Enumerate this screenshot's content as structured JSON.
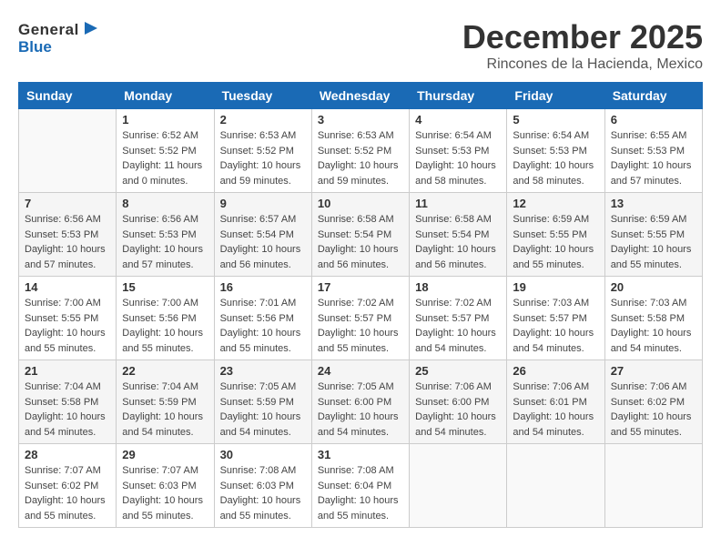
{
  "header": {
    "logo_general": "General",
    "logo_blue": "Blue",
    "month": "December 2025",
    "location": "Rincones de la Hacienda, Mexico"
  },
  "weekdays": [
    "Sunday",
    "Monday",
    "Tuesday",
    "Wednesday",
    "Thursday",
    "Friday",
    "Saturday"
  ],
  "weeks": [
    [
      {
        "day": "",
        "sunrise": "",
        "sunset": "",
        "daylight": ""
      },
      {
        "day": "1",
        "sunrise": "Sunrise: 6:52 AM",
        "sunset": "Sunset: 5:52 PM",
        "daylight": "Daylight: 11 hours and 0 minutes."
      },
      {
        "day": "2",
        "sunrise": "Sunrise: 6:53 AM",
        "sunset": "Sunset: 5:52 PM",
        "daylight": "Daylight: 10 hours and 59 minutes."
      },
      {
        "day": "3",
        "sunrise": "Sunrise: 6:53 AM",
        "sunset": "Sunset: 5:52 PM",
        "daylight": "Daylight: 10 hours and 59 minutes."
      },
      {
        "day": "4",
        "sunrise": "Sunrise: 6:54 AM",
        "sunset": "Sunset: 5:53 PM",
        "daylight": "Daylight: 10 hours and 58 minutes."
      },
      {
        "day": "5",
        "sunrise": "Sunrise: 6:54 AM",
        "sunset": "Sunset: 5:53 PM",
        "daylight": "Daylight: 10 hours and 58 minutes."
      },
      {
        "day": "6",
        "sunrise": "Sunrise: 6:55 AM",
        "sunset": "Sunset: 5:53 PM",
        "daylight": "Daylight: 10 hours and 57 minutes."
      }
    ],
    [
      {
        "day": "7",
        "sunrise": "Sunrise: 6:56 AM",
        "sunset": "Sunset: 5:53 PM",
        "daylight": "Daylight: 10 hours and 57 minutes."
      },
      {
        "day": "8",
        "sunrise": "Sunrise: 6:56 AM",
        "sunset": "Sunset: 5:53 PM",
        "daylight": "Daylight: 10 hours and 57 minutes."
      },
      {
        "day": "9",
        "sunrise": "Sunrise: 6:57 AM",
        "sunset": "Sunset: 5:54 PM",
        "daylight": "Daylight: 10 hours and 56 minutes."
      },
      {
        "day": "10",
        "sunrise": "Sunrise: 6:58 AM",
        "sunset": "Sunset: 5:54 PM",
        "daylight": "Daylight: 10 hours and 56 minutes."
      },
      {
        "day": "11",
        "sunrise": "Sunrise: 6:58 AM",
        "sunset": "Sunset: 5:54 PM",
        "daylight": "Daylight: 10 hours and 56 minutes."
      },
      {
        "day": "12",
        "sunrise": "Sunrise: 6:59 AM",
        "sunset": "Sunset: 5:55 PM",
        "daylight": "Daylight: 10 hours and 55 minutes."
      },
      {
        "day": "13",
        "sunrise": "Sunrise: 6:59 AM",
        "sunset": "Sunset: 5:55 PM",
        "daylight": "Daylight: 10 hours and 55 minutes."
      }
    ],
    [
      {
        "day": "14",
        "sunrise": "Sunrise: 7:00 AM",
        "sunset": "Sunset: 5:55 PM",
        "daylight": "Daylight: 10 hours and 55 minutes."
      },
      {
        "day": "15",
        "sunrise": "Sunrise: 7:00 AM",
        "sunset": "Sunset: 5:56 PM",
        "daylight": "Daylight: 10 hours and 55 minutes."
      },
      {
        "day": "16",
        "sunrise": "Sunrise: 7:01 AM",
        "sunset": "Sunset: 5:56 PM",
        "daylight": "Daylight: 10 hours and 55 minutes."
      },
      {
        "day": "17",
        "sunrise": "Sunrise: 7:02 AM",
        "sunset": "Sunset: 5:57 PM",
        "daylight": "Daylight: 10 hours and 55 minutes."
      },
      {
        "day": "18",
        "sunrise": "Sunrise: 7:02 AM",
        "sunset": "Sunset: 5:57 PM",
        "daylight": "Daylight: 10 hours and 54 minutes."
      },
      {
        "day": "19",
        "sunrise": "Sunrise: 7:03 AM",
        "sunset": "Sunset: 5:57 PM",
        "daylight": "Daylight: 10 hours and 54 minutes."
      },
      {
        "day": "20",
        "sunrise": "Sunrise: 7:03 AM",
        "sunset": "Sunset: 5:58 PM",
        "daylight": "Daylight: 10 hours and 54 minutes."
      }
    ],
    [
      {
        "day": "21",
        "sunrise": "Sunrise: 7:04 AM",
        "sunset": "Sunset: 5:58 PM",
        "daylight": "Daylight: 10 hours and 54 minutes."
      },
      {
        "day": "22",
        "sunrise": "Sunrise: 7:04 AM",
        "sunset": "Sunset: 5:59 PM",
        "daylight": "Daylight: 10 hours and 54 minutes."
      },
      {
        "day": "23",
        "sunrise": "Sunrise: 7:05 AM",
        "sunset": "Sunset: 5:59 PM",
        "daylight": "Daylight: 10 hours and 54 minutes."
      },
      {
        "day": "24",
        "sunrise": "Sunrise: 7:05 AM",
        "sunset": "Sunset: 6:00 PM",
        "daylight": "Daylight: 10 hours and 54 minutes."
      },
      {
        "day": "25",
        "sunrise": "Sunrise: 7:06 AM",
        "sunset": "Sunset: 6:00 PM",
        "daylight": "Daylight: 10 hours and 54 minutes."
      },
      {
        "day": "26",
        "sunrise": "Sunrise: 7:06 AM",
        "sunset": "Sunset: 6:01 PM",
        "daylight": "Daylight: 10 hours and 54 minutes."
      },
      {
        "day": "27",
        "sunrise": "Sunrise: 7:06 AM",
        "sunset": "Sunset: 6:02 PM",
        "daylight": "Daylight: 10 hours and 55 minutes."
      }
    ],
    [
      {
        "day": "28",
        "sunrise": "Sunrise: 7:07 AM",
        "sunset": "Sunset: 6:02 PM",
        "daylight": "Daylight: 10 hours and 55 minutes."
      },
      {
        "day": "29",
        "sunrise": "Sunrise: 7:07 AM",
        "sunset": "Sunset: 6:03 PM",
        "daylight": "Daylight: 10 hours and 55 minutes."
      },
      {
        "day": "30",
        "sunrise": "Sunrise: 7:08 AM",
        "sunset": "Sunset: 6:03 PM",
        "daylight": "Daylight: 10 hours and 55 minutes."
      },
      {
        "day": "31",
        "sunrise": "Sunrise: 7:08 AM",
        "sunset": "Sunset: 6:04 PM",
        "daylight": "Daylight: 10 hours and 55 minutes."
      },
      {
        "day": "",
        "sunrise": "",
        "sunset": "",
        "daylight": ""
      },
      {
        "day": "",
        "sunrise": "",
        "sunset": "",
        "daylight": ""
      },
      {
        "day": "",
        "sunrise": "",
        "sunset": "",
        "daylight": ""
      }
    ]
  ]
}
